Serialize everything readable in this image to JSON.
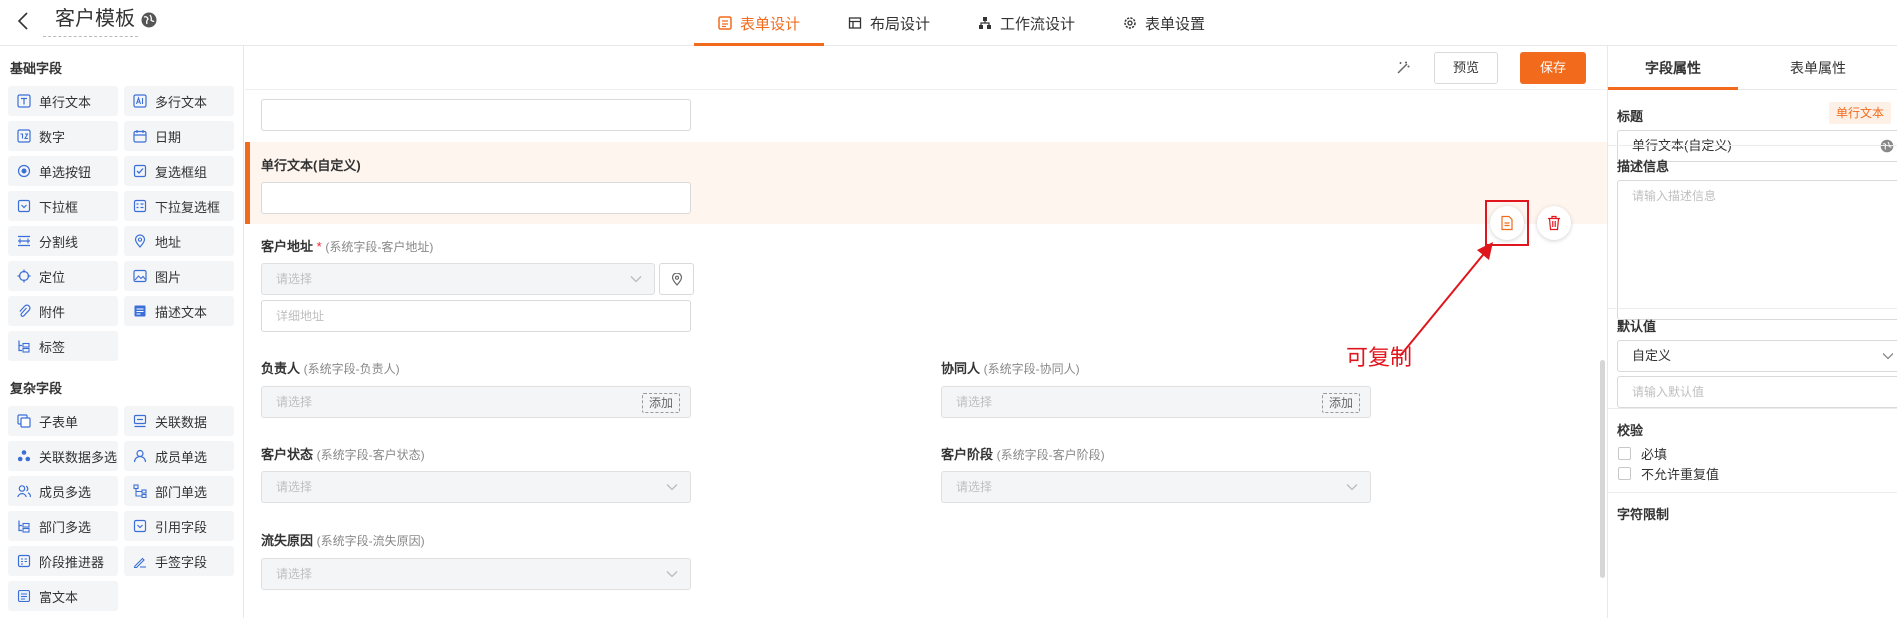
{
  "header": {
    "title": "客户模板",
    "tabs": [
      {
        "label": "表单设计",
        "icon": "form-icon",
        "active": true
      },
      {
        "label": "布局设计",
        "icon": "layout-icon",
        "active": false
      },
      {
        "label": "工作流设计",
        "icon": "workflow-icon",
        "active": false
      },
      {
        "label": "表单设置",
        "icon": "gear-icon",
        "active": false
      }
    ]
  },
  "palette": {
    "basic_title": "基础字段",
    "basic": [
      {
        "label": "单行文本",
        "icon": "text-icon"
      },
      {
        "label": "多行文本",
        "icon": "multiline-text-icon"
      },
      {
        "label": "数字",
        "icon": "number-icon"
      },
      {
        "label": "日期",
        "icon": "calendar-icon"
      },
      {
        "label": "单选按钮",
        "icon": "radio-icon"
      },
      {
        "label": "复选框组",
        "icon": "checkbox-icon"
      },
      {
        "label": "下拉框",
        "icon": "dropdown-icon"
      },
      {
        "label": "下拉复选框",
        "icon": "dropdown-checkbox-icon"
      },
      {
        "label": "分割线",
        "icon": "divider-icon"
      },
      {
        "label": "地址",
        "icon": "location-pin-icon"
      },
      {
        "label": "定位",
        "icon": "crosshair-icon"
      },
      {
        "label": "图片",
        "icon": "image-icon"
      },
      {
        "label": "附件",
        "icon": "paperclip-icon"
      },
      {
        "label": "描述文本",
        "icon": "description-icon"
      },
      {
        "label": "标签",
        "icon": "tag-tree-icon"
      }
    ],
    "complex_title": "复杂字段",
    "complex": [
      {
        "label": "子表单",
        "icon": "subform-icon"
      },
      {
        "label": "关联数据",
        "icon": "linked-data-icon"
      },
      {
        "label": "关联数据多选",
        "icon": "linked-multi-icon"
      },
      {
        "label": "成员单选",
        "icon": "user-icon"
      },
      {
        "label": "成员多选",
        "icon": "users-icon"
      },
      {
        "label": "部门单选",
        "icon": "department-icon"
      },
      {
        "label": "部门多选",
        "icon": "department-multi-icon"
      },
      {
        "label": "引用字段",
        "icon": "reference-icon"
      },
      {
        "label": "阶段推进器",
        "icon": "stage-icon"
      },
      {
        "label": "手签字段",
        "icon": "signature-icon"
      },
      {
        "label": "富文本",
        "icon": "rich-text-icon"
      }
    ]
  },
  "toolbar": {
    "preview_label": "预览",
    "save_label": "保存"
  },
  "canvas": {
    "selected_field": {
      "label": "单行文本(自定义)"
    },
    "address": {
      "label": "客户地址",
      "required_mark": "*",
      "sys_note": "(系统字段-客户地址)",
      "select_placeholder": "请选择",
      "detail_placeholder": "详细地址"
    },
    "owner": {
      "label": "负责人",
      "sys_note": "(系统字段-负责人)",
      "placeholder": "请选择",
      "add_label": "添加"
    },
    "collaborator": {
      "label": "协同人",
      "sys_note": "(系统字段-协同人)",
      "placeholder": "请选择",
      "add_label": "添加"
    },
    "status": {
      "label": "客户状态",
      "sys_note": "(系统字段-客户状态)",
      "placeholder": "请选择"
    },
    "stage": {
      "label": "客户阶段",
      "sys_note": "(系统字段-客户阶段)",
      "placeholder": "请选择"
    },
    "loss_reason": {
      "label": "流失原因",
      "sys_note": "(系统字段-流失原因)",
      "placeholder": "请选择"
    },
    "annotation": "可复制"
  },
  "properties": {
    "tabs": [
      {
        "label": "字段属性",
        "active": true
      },
      {
        "label": "表单属性",
        "active": false
      }
    ],
    "title_label": "标题",
    "type_badge": "单行文本",
    "title_value": "单行文本(自定义)",
    "desc_label": "描述信息",
    "desc_placeholder": "请输入描述信息",
    "default_label": "默认值",
    "default_mode": "自定义",
    "default_placeholder": "请输入默认值",
    "validation_label": "校验",
    "required_label": "必填",
    "no_duplicate_label": "不允许重复值",
    "char_limit_label": "字符限制"
  },
  "colors": {
    "accent": "#f26b1d",
    "annotation": "#e0161d",
    "selected_bg": "#fdf5ee"
  }
}
